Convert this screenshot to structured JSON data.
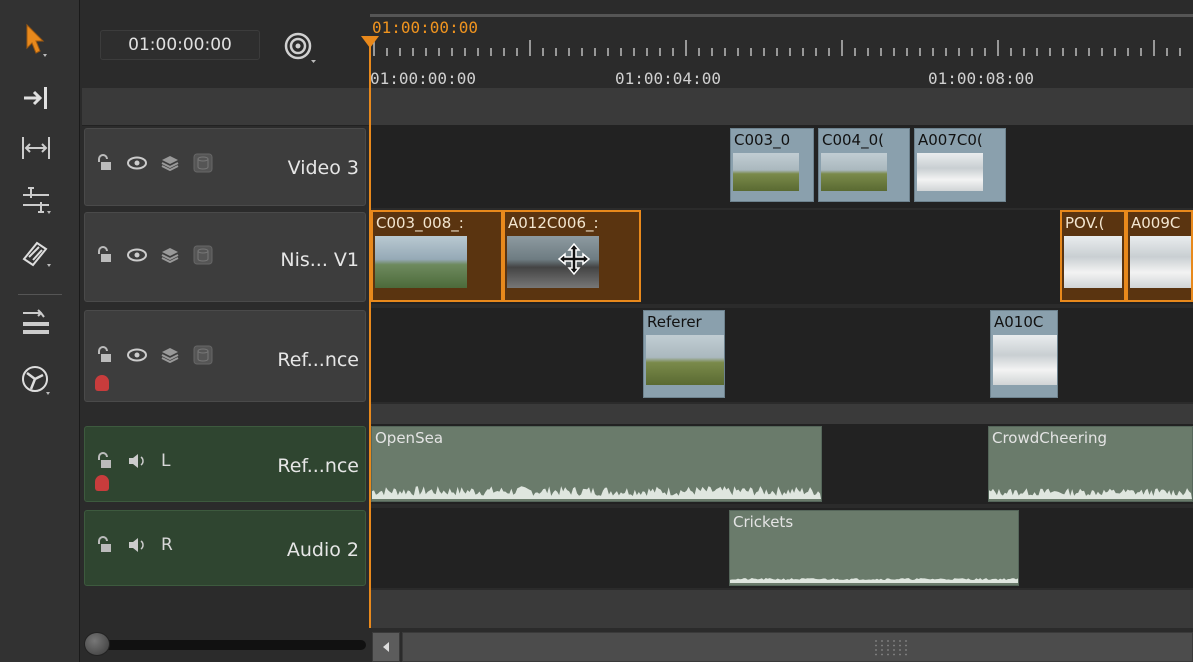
{
  "header": {
    "timecode": "01:00:00:00"
  },
  "ruler": {
    "current_time": "01:00:00:00",
    "labels": [
      "01:00:00:00",
      "01:00:04:00",
      "01:00:08:00"
    ]
  },
  "tracks": {
    "video3": {
      "name": "Video 3"
    },
    "v1": {
      "name": "Nis... V1"
    },
    "ref": {
      "name": "Ref...nce"
    },
    "audio_ref": {
      "name": "Ref...nce",
      "channel": "L"
    },
    "audio2": {
      "name": "Audio 2",
      "channel": "R"
    }
  },
  "clips": {
    "video3": [
      "C003_0",
      "C004_0(",
      "A007C0("
    ],
    "v1": [
      "C003_008_:",
      "A012C006_:",
      "POV.(",
      "A009C"
    ],
    "ref": [
      "Referer",
      "A010C"
    ],
    "audio_ref": [
      "OpenSea",
      "CrowdCheering"
    ],
    "audio2": [
      "Crickets"
    ]
  },
  "colors": {
    "accent": "#e8891c",
    "video_clip": "#8aa0ad",
    "audio_clip": "#6a7b6b",
    "audio_track": "#2f4530"
  },
  "icons": [
    "select-arrow-icon",
    "track-forward-icon",
    "ripple-icon",
    "slip-icon",
    "razor-icon",
    "multitrack-icon",
    "retime-icon",
    "snap-icon",
    "lock-icon",
    "eye-icon",
    "layers-icon",
    "disk-icon",
    "speaker-icon"
  ]
}
